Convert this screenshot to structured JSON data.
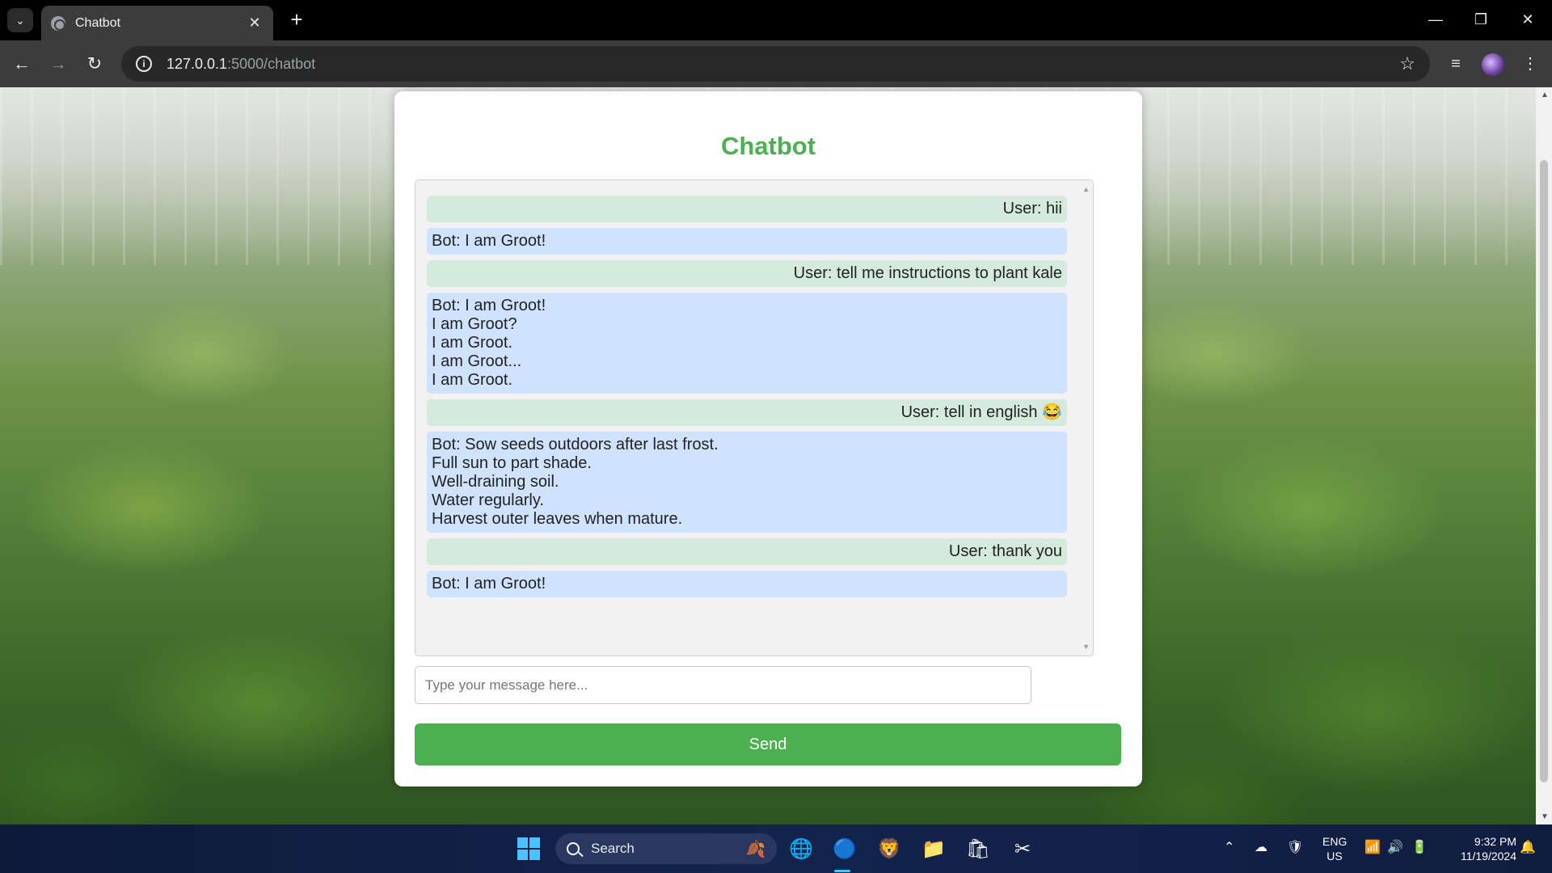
{
  "browser": {
    "tab_title": "Chatbot",
    "url_host": "127.0.0.1",
    "url_rest": ":5000/chatbot"
  },
  "page": {
    "title": "Chatbot",
    "messages": [
      {
        "role": "user",
        "text": "User: hii"
      },
      {
        "role": "bot",
        "text": "Bot: I am Groot!"
      },
      {
        "role": "user",
        "text": "User: tell me instructions to plant kale"
      },
      {
        "role": "bot",
        "text": "Bot: I am Groot!\nI am Groot?\nI am Groot.\nI am Groot...\nI am Groot."
      },
      {
        "role": "user",
        "text": "User: tell in english 😂"
      },
      {
        "role": "bot",
        "text": "Bot: Sow seeds outdoors after last frost.\nFull sun to part shade.\nWell-draining soil.\nWater regularly.\nHarvest outer leaves when mature."
      },
      {
        "role": "user",
        "text": "User: thank you"
      },
      {
        "role": "bot",
        "text": "Bot: I am Groot!"
      }
    ],
    "input_placeholder": "Type your message here...",
    "input_value": "",
    "send_label": "Send",
    "colors": {
      "accent": "#4caf50",
      "user_bubble": "#d4eadd",
      "bot_bubble": "#cfe2ff"
    }
  },
  "taskbar": {
    "search_label": "Search",
    "lang_top": "ENG",
    "lang_bottom": "US",
    "time": "9:32 PM",
    "date": "11/19/2024"
  }
}
